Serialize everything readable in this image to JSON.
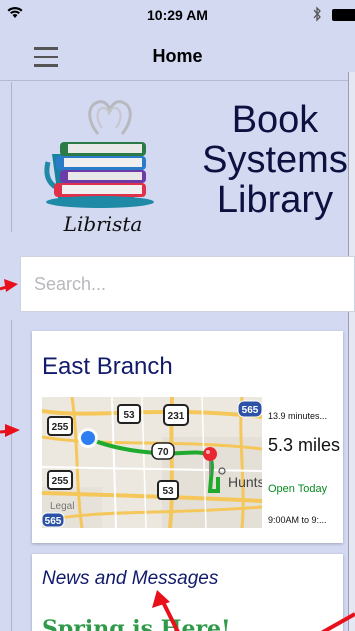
{
  "status_bar": {
    "time": "10:29 AM",
    "icons": [
      "wifi-icon",
      "bluetooth-icon",
      "battery-icon"
    ]
  },
  "nav": {
    "title": "Home",
    "menu_icon": "hamburger-menu-icon"
  },
  "logo": {
    "text": "Librista",
    "icon": "book-stack-cup-icon"
  },
  "library": {
    "title_lines": [
      "Book",
      "Systems",
      "Library"
    ]
  },
  "search": {
    "placeholder": "Search...",
    "value": ""
  },
  "branch": {
    "name": "East Branch",
    "eta": "13.9 minutes...",
    "distance": "5.3 miles",
    "status": "Open Today",
    "hours": "9:00AM to 9:...",
    "map": {
      "labels": [
        "Hunts",
        "Legal"
      ],
      "shields": [
        "255",
        "53",
        "231",
        "565",
        "70",
        "255",
        "53",
        "565"
      ]
    }
  },
  "news": {
    "title": "News and Messages",
    "headline": "Spring is Here!"
  },
  "colors": {
    "background": "#d4d9f2",
    "title_text": "#0d1140",
    "branch_title": "#111a6b",
    "open_status": "#0a8a22",
    "route": "#1faa2e",
    "headline": "#2f9a4a",
    "annotation_arrow": "#e8101a"
  }
}
